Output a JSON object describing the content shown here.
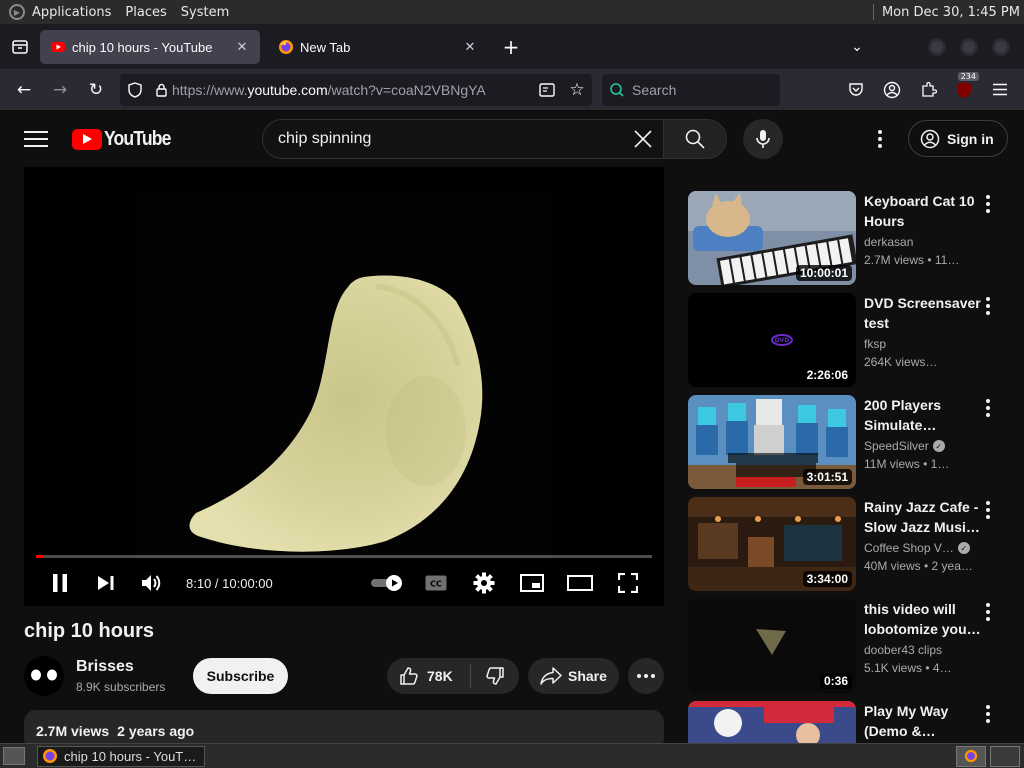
{
  "panel": {
    "menus": [
      "Applications",
      "Places",
      "System"
    ],
    "clock": "Mon Dec 30,  1:45 PM"
  },
  "browser": {
    "tabs": [
      {
        "title": "chip 10 hours - YouTube",
        "active": true
      },
      {
        "title": "New Tab",
        "active": false
      }
    ],
    "url_prefix": "https://www.",
    "url_host": "youtube.com",
    "url_path": "/watch?v=coaN2VBNgYA",
    "search_placeholder": "Search",
    "extension_badge": "234"
  },
  "youtube": {
    "logo_text": "YouTube",
    "search_value": "chip spinning",
    "sign_in_label": "Sign in"
  },
  "player": {
    "time": "8:10 / 10:00:00",
    "progress_fraction": 0.0136
  },
  "video": {
    "title": "chip 10 hours",
    "channel": "Brisses",
    "subscribers": "8.9K subscribers",
    "subscribe_label": "Subscribe",
    "likes": "78K",
    "share_label": "Share",
    "views": "2.7M views",
    "age": "2 years ago"
  },
  "related": [
    {
      "title": "Keyboard Cat 10 Hours",
      "channel": "derkasan",
      "verified": false,
      "meta": "2.7M views  • 11…",
      "duration": "10:00:01",
      "thumb": "keyboard-cat"
    },
    {
      "title": "DVD Screensaver test",
      "channel": "fksp",
      "verified": false,
      "meta": "264K views…",
      "duration": "2:26:06",
      "thumb": "dvd"
    },
    {
      "title": "200 Players Simulate…",
      "channel": "SpeedSilver",
      "verified": true,
      "meta": "11M views  • 1…",
      "duration": "3:01:51",
      "thumb": "minecraft"
    },
    {
      "title": "Rainy Jazz Cafe - Slow Jazz Musi…",
      "channel": "Coffee Shop V…",
      "verified": true,
      "meta": "40M views  • 2 yea…",
      "duration": "3:34:00",
      "thumb": "cafe"
    },
    {
      "title": "this video will lobotomize you…",
      "channel": "doober43 clips",
      "verified": false,
      "meta": "5.1K views  • 4…",
      "duration": "0:36",
      "thumb": "chip-dark"
    },
    {
      "title": "Play My Way (Demo &…",
      "channel": "",
      "verified": false,
      "meta": "",
      "duration": "",
      "thumb": "anime"
    }
  ],
  "taskbar": {
    "task_title": "chip 10 hours - YouT…"
  },
  "colors": {
    "yt_red": "#ff0000",
    "page_bg": "#0f0f0f",
    "chip": "#d9d49a"
  }
}
